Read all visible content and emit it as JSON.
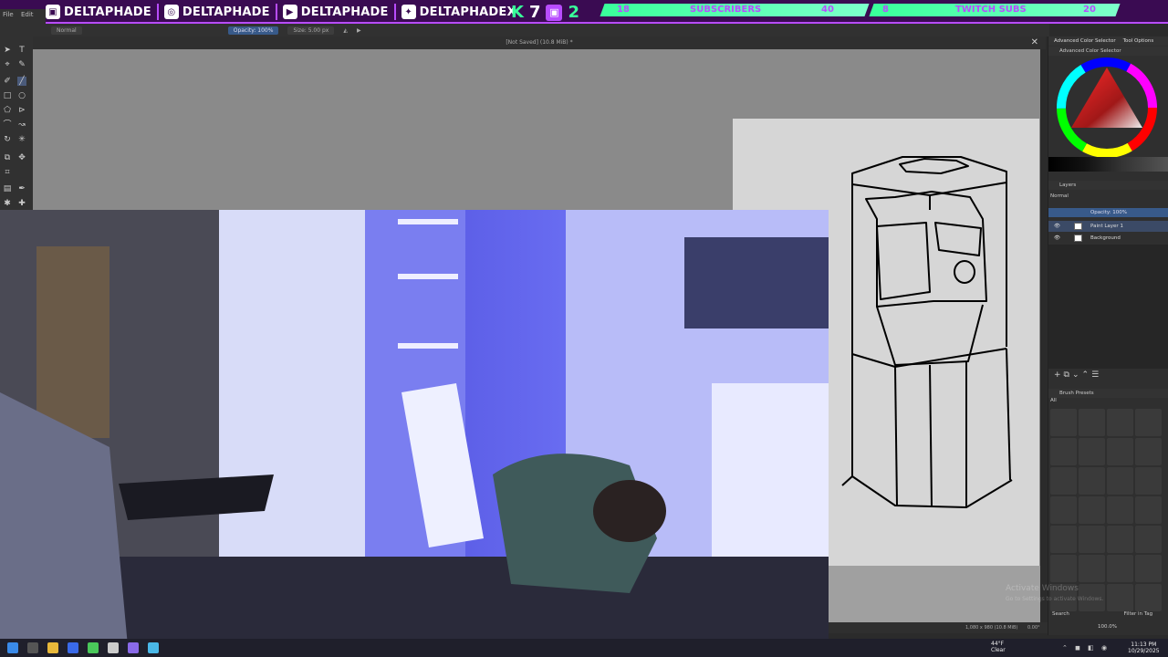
{
  "overlay": {
    "socials": [
      {
        "icon": "twitch-icon",
        "handle": "DELTAPHADE"
      },
      {
        "icon": "instagram-icon",
        "handle": "DELTAPHADE"
      },
      {
        "icon": "youtube-icon",
        "handle": "DELTAPHADE"
      },
      {
        "icon": "twitter-icon",
        "handle": "DELTAPHADEX"
      }
    ],
    "kick_count": "7",
    "twitch_count": "2",
    "subscribers_current": "18",
    "subscribers_label": "SUBSCRIBERS",
    "subscribers_goal": "40",
    "twitch_subs_current": "8",
    "twitch_subs_label": "TWITCH SUBS",
    "twitch_subs_goal": "20"
  },
  "krita": {
    "menu": [
      "File",
      "Edit"
    ],
    "blend_mode": "Normal",
    "opacity_label": "Opacity: 100%",
    "size_label": "Size: 5.00 px",
    "document_title": "[Not Saved]  (10.8 MiB) *",
    "status_dimensions": "1,080 x 980 (10.8 MiB)",
    "status_angle": "0.00°",
    "status_zoom": "100.0%",
    "docker": {
      "tab_color_selector": "Advanced Color Selector",
      "tab_tool_options": "Tool Options",
      "color_selector_title": "Advanced Color Selector",
      "layers_title": "Layers",
      "layers_blend": "Normal",
      "layers_opacity": "Opacity:  100%",
      "layers": [
        {
          "name": "Paint Layer 1",
          "selected": true
        },
        {
          "name": "Background",
          "selected": false
        }
      ],
      "brush_presets_title": "Brush Presets",
      "brush_tag": "All",
      "brush_filter": "Filter in Tag",
      "search_placeholder": "Search"
    }
  },
  "watermark": {
    "title": "Activate Windows",
    "subtitle": "Go to Settings to activate Windows."
  },
  "taskbar": {
    "weather_temp": "44°F",
    "weather_desc": "Clear",
    "time": "11:13 PM",
    "date": "10/29/2025"
  },
  "colors": {
    "overlay_bg": "#3a0b52",
    "overlay_accent": "#b84cff",
    "overlay_green": "#39ff9a",
    "canvas_gray": "#8a8a8a"
  }
}
